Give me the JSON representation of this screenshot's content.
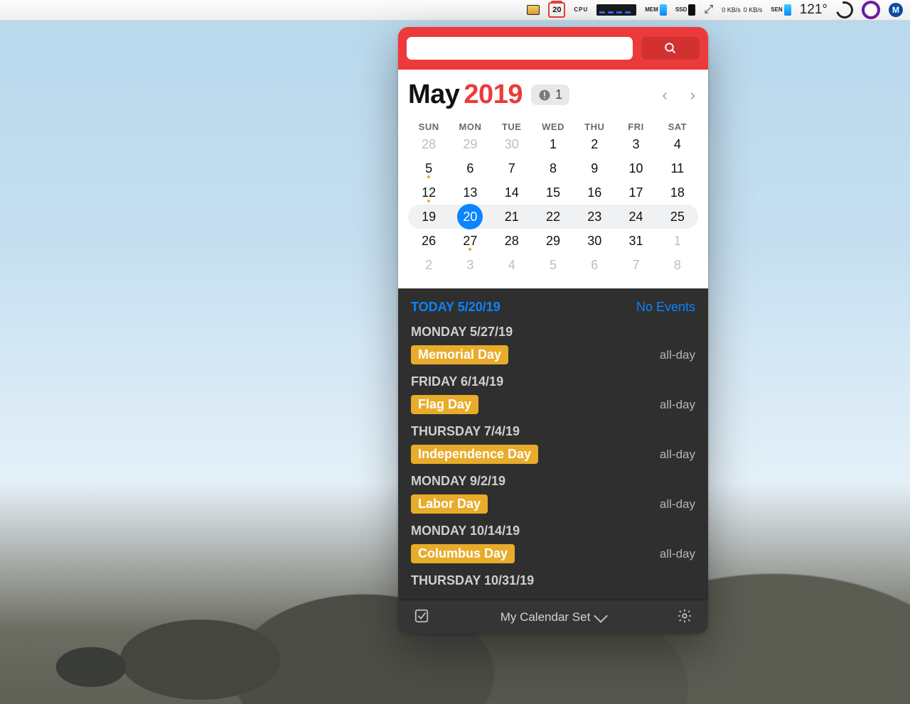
{
  "menubar": {
    "cal_day": "20",
    "cpu_label": "CPU",
    "mem_label": "MEM",
    "ssd_label": "SSD",
    "sen_label": "SEN",
    "net_up": "0 KB/s",
    "net_down": "0 KB/s",
    "temperature": "121°",
    "m_glyph": "M"
  },
  "search": {
    "placeholder": ""
  },
  "header": {
    "month": "May",
    "year": "2019",
    "badge_count": "1"
  },
  "dow": [
    "SUN",
    "MON",
    "TUE",
    "WED",
    "THU",
    "FRI",
    "SAT"
  ],
  "weeks": [
    {
      "current": false,
      "days": [
        {
          "n": "28",
          "out": true
        },
        {
          "n": "29",
          "out": true
        },
        {
          "n": "30",
          "out": true
        },
        {
          "n": "1"
        },
        {
          "n": "2"
        },
        {
          "n": "3"
        },
        {
          "n": "4"
        }
      ]
    },
    {
      "current": false,
      "days": [
        {
          "n": "5",
          "dot": true
        },
        {
          "n": "6"
        },
        {
          "n": "7"
        },
        {
          "n": "8"
        },
        {
          "n": "9"
        },
        {
          "n": "10"
        },
        {
          "n": "11"
        }
      ]
    },
    {
      "current": false,
      "days": [
        {
          "n": "12",
          "dot": true
        },
        {
          "n": "13"
        },
        {
          "n": "14"
        },
        {
          "n": "15"
        },
        {
          "n": "16"
        },
        {
          "n": "17"
        },
        {
          "n": "18"
        }
      ]
    },
    {
      "current": true,
      "days": [
        {
          "n": "19"
        },
        {
          "n": "20",
          "today": true
        },
        {
          "n": "21"
        },
        {
          "n": "22"
        },
        {
          "n": "23"
        },
        {
          "n": "24"
        },
        {
          "n": "25"
        }
      ]
    },
    {
      "current": false,
      "days": [
        {
          "n": "26"
        },
        {
          "n": "27",
          "dot": true
        },
        {
          "n": "28"
        },
        {
          "n": "29"
        },
        {
          "n": "30"
        },
        {
          "n": "31"
        },
        {
          "n": "1",
          "out": true
        }
      ]
    },
    {
      "current": false,
      "days": [
        {
          "n": "2",
          "out": true
        },
        {
          "n": "3",
          "out": true
        },
        {
          "n": "4",
          "out": true
        },
        {
          "n": "5",
          "out": true
        },
        {
          "n": "6",
          "out": true
        },
        {
          "n": "7",
          "out": true
        },
        {
          "n": "8",
          "out": true
        }
      ]
    }
  ],
  "today": {
    "label": "TODAY 5/20/19",
    "status": "No Events"
  },
  "events": [
    {
      "date": "MONDAY 5/27/19",
      "title": "Memorial Day",
      "when": "all-day"
    },
    {
      "date": "FRIDAY 6/14/19",
      "title": "Flag Day",
      "when": "all-day"
    },
    {
      "date": "THURSDAY 7/4/19",
      "title": "Independence Day",
      "when": "all-day"
    },
    {
      "date": "MONDAY 9/2/19",
      "title": "Labor Day",
      "when": "all-day"
    },
    {
      "date": "MONDAY 10/14/19",
      "title": "Columbus Day",
      "when": "all-day"
    },
    {
      "date": "THURSDAY 10/31/19",
      "title": "",
      "when": ""
    }
  ],
  "bottom": {
    "set_label": "My Calendar Set"
  }
}
